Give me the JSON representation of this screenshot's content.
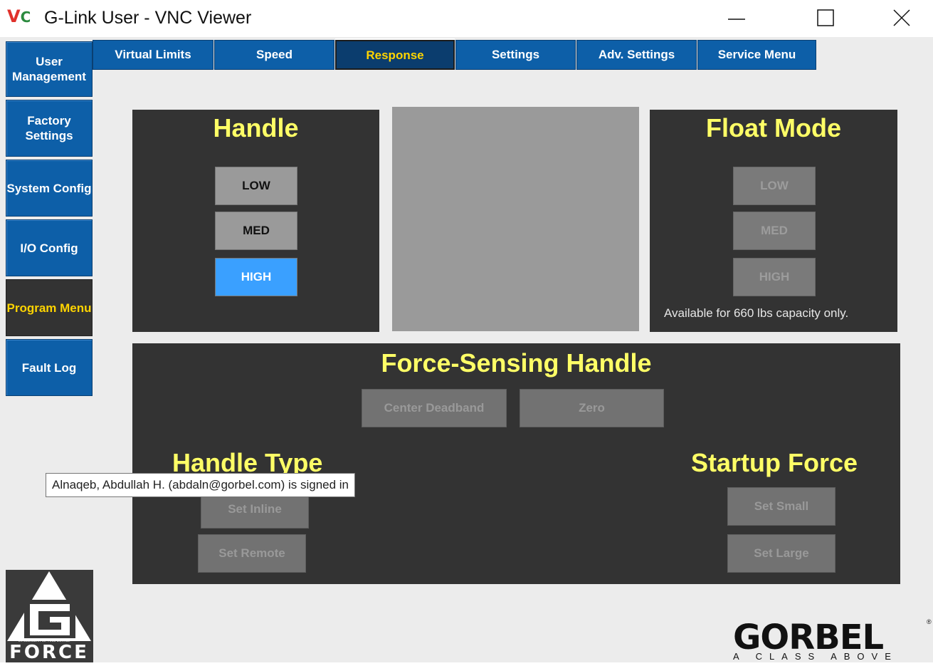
{
  "window": {
    "logo_v": "V",
    "logo_c": "C",
    "title": "G-Link User - VNC Viewer",
    "minimize": "minimize-icon",
    "maximize": "maximize-icon",
    "close": "close-icon"
  },
  "sidebar": {
    "items": [
      {
        "label": "User Management"
      },
      {
        "label": "Factory Settings"
      },
      {
        "label": "System Config"
      },
      {
        "label": "I/O Config"
      },
      {
        "label": "Program Menu",
        "active": true
      },
      {
        "label": "Fault Log"
      }
    ]
  },
  "tabs": [
    {
      "label": "Virtual Limits"
    },
    {
      "label": "Speed"
    },
    {
      "label": "Response",
      "active": true
    },
    {
      "label": "Settings"
    },
    {
      "label": "Adv. Settings"
    },
    {
      "label": "Service Menu"
    }
  ],
  "handle": {
    "title": "Handle",
    "options": [
      "LOW",
      "MED",
      "HIGH"
    ],
    "selected": "HIGH"
  },
  "float_mode": {
    "title": "Float Mode",
    "options": [
      "LOW",
      "MED",
      "HIGH"
    ],
    "note": "Available for 660 lbs capacity only."
  },
  "force_sensing": {
    "title": "Force-Sensing Handle",
    "center_deadband": "Center Deadband",
    "zero": "Zero"
  },
  "handle_type": {
    "title": "Handle Type",
    "set_inline": "Set Inline",
    "set_remote": "Set Remote"
  },
  "startup_force": {
    "title": "Startup Force",
    "set_small": "Set Small",
    "set_large": "Set Large"
  },
  "tooltip": "Alnaqeb, Abdullah H. (abdaln@gorbel.com) is signed in",
  "logos": {
    "gforce_word": "FORCE",
    "gforce_tagline": "INTELLIGENT LIFTING DEVICE",
    "gorbel_word": "GORBEL",
    "gorbel_reg": "®",
    "gorbel_tagline": "A CLASS ABOVE"
  },
  "colors": {
    "accent_blue": "#0d5fa8",
    "active_gold": "#ffd400",
    "panel_dark": "#333333",
    "title_yellow": "#ffff66",
    "selected_blue": "#3aa0ff"
  }
}
